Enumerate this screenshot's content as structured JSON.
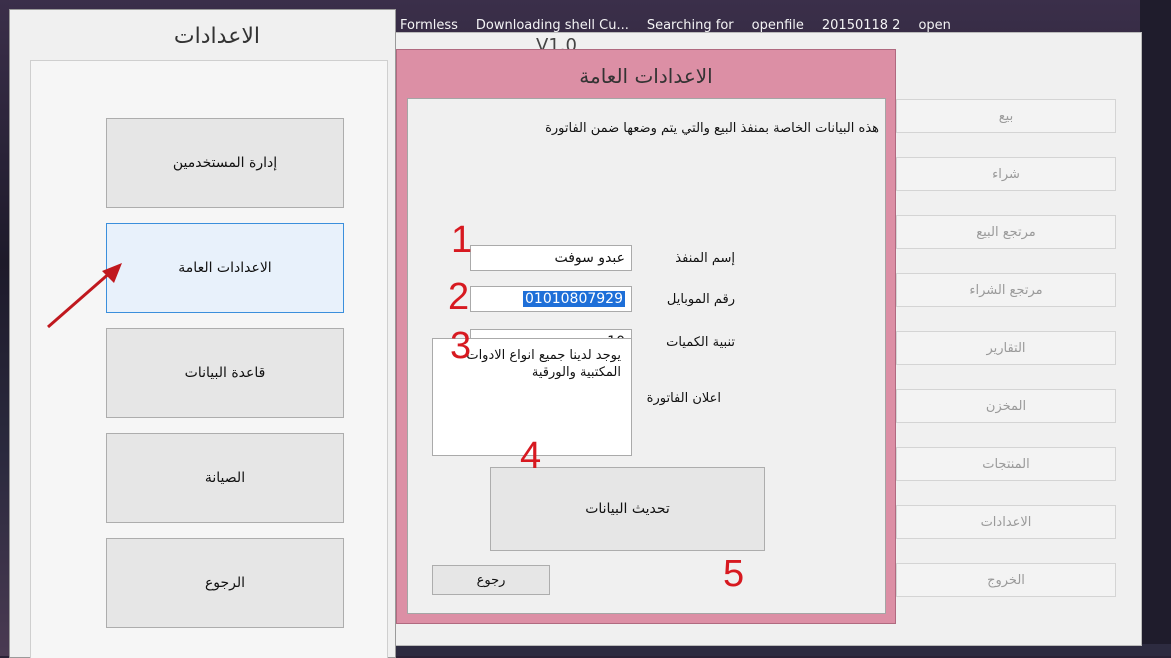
{
  "desktop": {
    "top_items": [
      "Formless",
      "Downloading shell Cu...",
      "Searching for",
      "openfile",
      "20150118 2",
      "open"
    ]
  },
  "left_window": {
    "title": "الاعدادات",
    "buttons": [
      {
        "label": "إدارة المستخدمين"
      },
      {
        "label": "الاعدادات العامة"
      },
      {
        "label": "قاعدة البيانات"
      },
      {
        "label": "الصيانة"
      },
      {
        "label": "الرجوع"
      }
    ]
  },
  "main_window": {
    "ghost_title": "V1.0",
    "menu": [
      "بيع",
      "شراء",
      "مرتجع البيع",
      "مرتجع الشراء",
      "التقارير",
      "المخزن",
      "المنتجات",
      "الاعدادات",
      "الخروج"
    ]
  },
  "modal": {
    "title": "الاعدادات العامة",
    "description": "هذه البيانات الخاصة بمنفذ البيع والتي يتم وضعها ضمن الفاتورة",
    "fields": {
      "outlet_name": {
        "label": "إسم المنفذ",
        "value": "عبدو سوفت"
      },
      "mobile": {
        "label": "رقم الموبايل",
        "value": "01010807929"
      },
      "qty_alert": {
        "label": "تنبية الكميات",
        "value": "10"
      },
      "invoice_ad": {
        "label": "اعلان الفاتورة",
        "value": "يوجد لدينا جميع انواع الادوات المكتبية والورقية"
      }
    },
    "update_label": "تحديث البيانات",
    "back_label": "رجوع"
  },
  "annotations": [
    "1",
    "2",
    "3",
    "4",
    "5"
  ],
  "colors": {
    "modal_frame": "#dc8fa5",
    "annotation": "#d71920",
    "selection": "#1e6fd8"
  }
}
